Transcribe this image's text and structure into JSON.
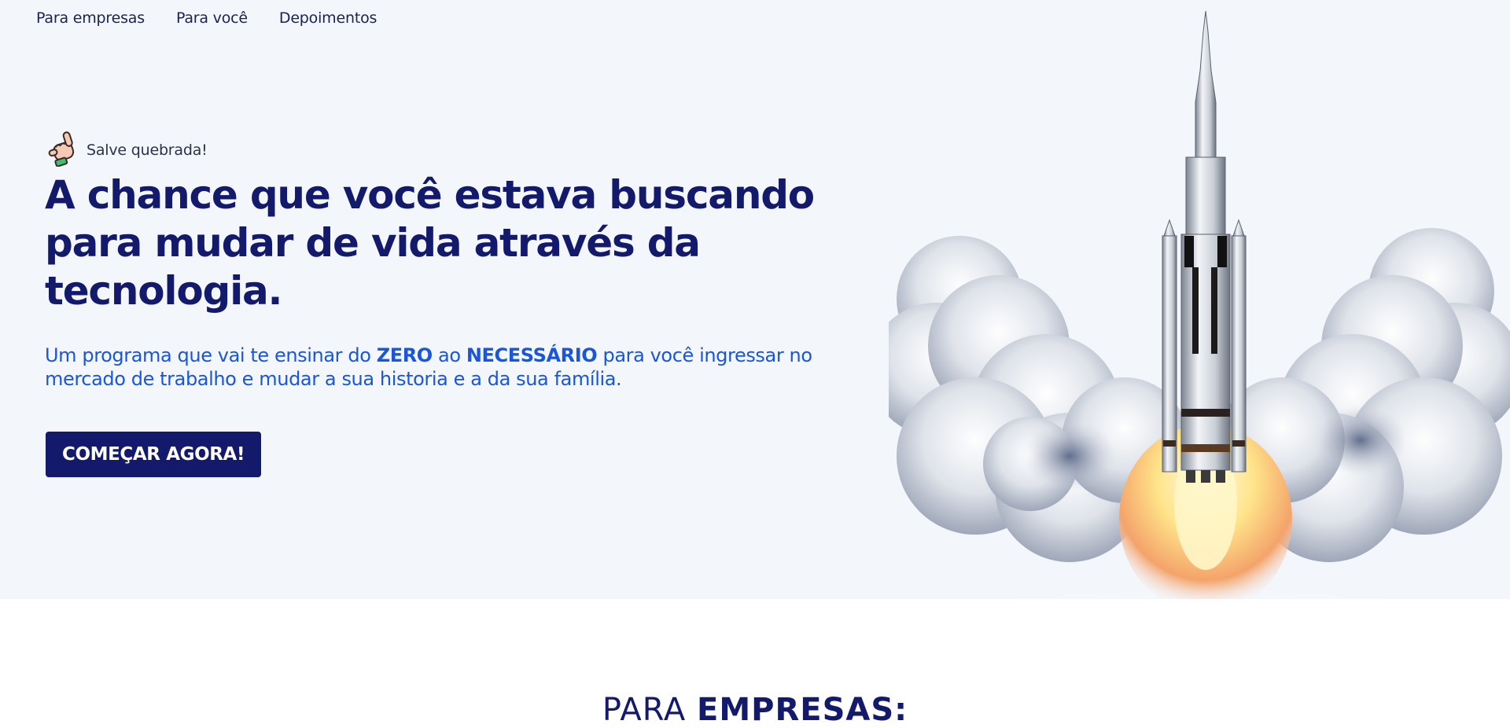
{
  "nav": {
    "items": [
      {
        "label": "Para empresas"
      },
      {
        "label": "Para você"
      },
      {
        "label": "Depoimentos"
      }
    ]
  },
  "hero": {
    "greeting": "Salve quebrada!",
    "greeting_icon": "shaka-hand-icon",
    "headline_lines": [
      "A chance que você estava buscando",
      "para mudar de vida através da",
      "tecnologia."
    ],
    "subtitle": {
      "part1": "Um programa que vai te ensinar do ",
      "bold1": "ZERO",
      "part2": " ao ",
      "bold2": "NECESSÁRIO",
      "part3": " para você ingressar no",
      "line2": "mercado de trabalho e mudar a sua historia e a da sua família."
    },
    "cta_label": "COMEÇAR AGORA!",
    "image": "rocket-launch-illustration"
  },
  "section": {
    "title_light": "PARA ",
    "title_bold": "EMPRESAS:"
  },
  "colors": {
    "hero_background": "#f3f6fb",
    "headline": "#141a6b",
    "subtitle": "#1a56db",
    "cta_background": "#141a6b",
    "nav_text": "#1c2252"
  }
}
